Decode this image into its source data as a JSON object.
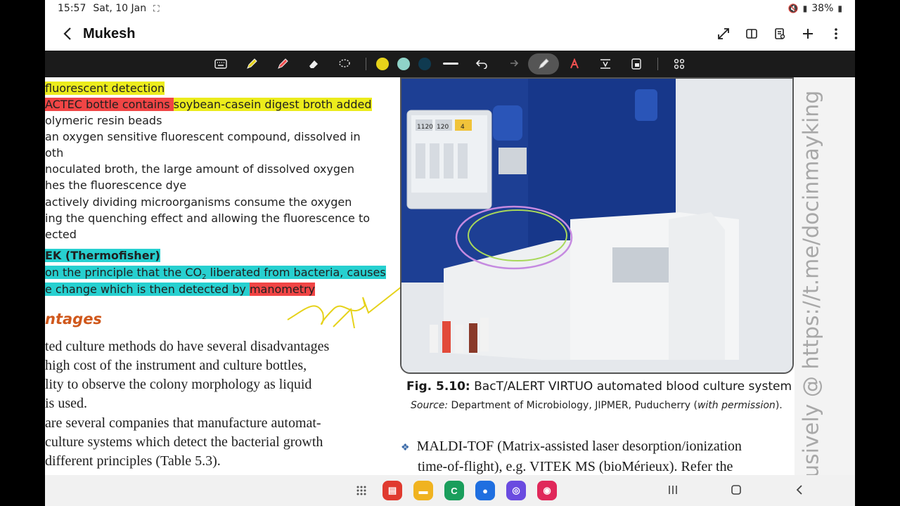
{
  "status": {
    "time": "15:57",
    "date": "Sat, 10 Jan",
    "battery": "38%"
  },
  "header": {
    "title": "Mukesh"
  },
  "toolbar": {
    "colors": [
      "#e6d21a",
      "#8fd3c8",
      "#0f3a50"
    ]
  },
  "page": {
    "left_lines": [
      "fluorescent detection",
      "ACTEC bottle contains soybean-casein digest broth added",
      "olymeric resin beads",
      " an oxygen sensitive fluorescent compound, dissolved in",
      "oth",
      "noculated broth, the large amount of dissolved oxygen",
      "hes the fluorescence dye",
      "actively dividing microorganisms consume the oxygen",
      "ing the quenching effect and allowing the fluorescence to",
      "ected",
      "EK (Thermofisher)",
      "on the principle that the CO",
      "2",
      " liberated from bacteria, causes",
      "e change which is then detected by ",
      "manometry"
    ],
    "section_heading": "ntages",
    "body_lines": [
      "ted culture methods do have several disadvantages",
      "high cost of the instrument and culture bottles,",
      "lity to observe the colony morphology as liquid",
      " is used.",
      " are several companies that manufacture automat-",
      " culture systems which detect the bacterial growth",
      " different principles (Table 5.3)."
    ],
    "figure": {
      "screen_values": [
        "1120",
        "120",
        "4"
      ],
      "caption_label": "Fig. 5.10:",
      "caption_text": " BacT/ALERT VIRTUO automated blood culture system",
      "source_label": "Source:",
      "source_text": " Department of Microbiology, JIPMER, Puducherry (",
      "source_italic": "with permission",
      "source_end": ")."
    },
    "maldi_line1": "MALDI-TOF (Matrix-assisted laser desorption/ionization",
    "maldi_line2": "time-of-flight), e.g. VITEK MS (bioMérieux). Refer the",
    "watermark": "usively @ https://t.me/docinmayking"
  },
  "dock": {
    "apps": [
      {
        "name": "apps-grid",
        "color": "transparent"
      },
      {
        "name": "flipboard",
        "color": "#e03a2f"
      },
      {
        "name": "files",
        "color": "#f0b320"
      },
      {
        "name": "classroom",
        "color": "#1a9e5c"
      },
      {
        "name": "messages",
        "color": "#1f6fe0"
      },
      {
        "name": "browser",
        "color": "#6a4be0"
      },
      {
        "name": "camera",
        "color": "#e0285a"
      }
    ]
  }
}
